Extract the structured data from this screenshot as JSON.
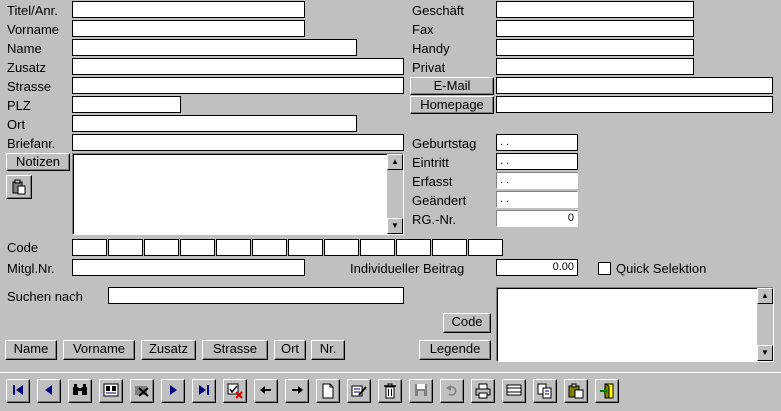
{
  "labels": {
    "titel": "Titel/Anr.",
    "vorname": "Vorname",
    "name": "Name",
    "zusatz": "Zusatz",
    "strasse": "Strasse",
    "plz": "PLZ",
    "ort": "Ort",
    "briefanr": "Briefanr.",
    "geschaeft": "Geschäft",
    "fax": "Fax",
    "handy": "Handy",
    "privat": "Privat",
    "geburtstag": "Geburtstag",
    "eintritt": "Eintritt",
    "erfasst": "Erfasst",
    "geaendert": "Geändert",
    "rgnr": "RG.-Nr.",
    "code": "Code",
    "mitglnr": "Mitgl.Nr.",
    "beitrag": "Individueller Beitrag",
    "quick": "Quick Selektion",
    "suchen": "Suchen nach"
  },
  "values": {
    "titel": "",
    "vorname": "",
    "name": "",
    "zusatz": "",
    "strasse": "",
    "plz": "",
    "ort": "",
    "briefanr": "",
    "geschaeft": "",
    "fax": "",
    "handy": "",
    "privat": "",
    "email": "",
    "homepage": "",
    "geburtstag": " . .",
    "eintritt": " . .",
    "erfasst": " . .",
    "geaendert": " . .",
    "rgnr": "0",
    "mitglnr": "",
    "beitrag": "0.00",
    "suchen": "",
    "notizen": "",
    "legende_text": ""
  },
  "buttons": {
    "email": "E-Mail",
    "homepage": "Homepage",
    "notizen": "Notizen",
    "code": "Code",
    "legende": "Legende",
    "search": [
      "Name",
      "Vorname",
      "Zusatz",
      "Strasse",
      "Ort",
      "Nr."
    ]
  },
  "code_boxes": [
    "",
    "",
    "",
    "",
    "",
    "",
    "",
    "",
    "",
    "",
    "",
    ""
  ],
  "quick_selection_checked": false,
  "toolbar": [
    {
      "icon": "first-record-icon"
    },
    {
      "icon": "previous-record-icon"
    },
    {
      "icon": "binoculars-icon"
    },
    {
      "icon": "search-list-icon"
    },
    {
      "icon": "filter-off-icon"
    },
    {
      "icon": "next-record-icon"
    },
    {
      "icon": "last-record-icon"
    },
    {
      "icon": "delete-mark-icon"
    },
    {
      "icon": "arrow-left-icon"
    },
    {
      "icon": "arrow-right-icon"
    },
    {
      "icon": "new-document-icon"
    },
    {
      "icon": "edit-icon"
    },
    {
      "icon": "trash-icon"
    },
    {
      "icon": "save-icon"
    },
    {
      "icon": "undo-icon"
    },
    {
      "icon": "print-icon"
    },
    {
      "icon": "form-view-icon"
    },
    {
      "icon": "copy-icon"
    },
    {
      "icon": "paste-icon"
    },
    {
      "icon": "exit-icon"
    }
  ]
}
